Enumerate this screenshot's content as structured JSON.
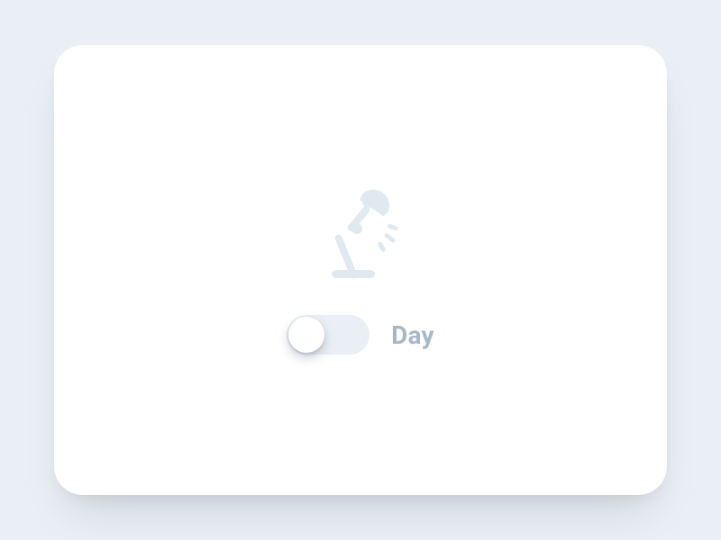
{
  "toggle": {
    "label": "Day",
    "state": "off"
  },
  "icon": {
    "name": "desk-lamp"
  },
  "colors": {
    "background": "#e9eff4",
    "card": "#ffffff",
    "icon": "#e1e9f0",
    "track": "#e9eff4",
    "knob": "#ffffff",
    "label": "#a9b8c7"
  }
}
